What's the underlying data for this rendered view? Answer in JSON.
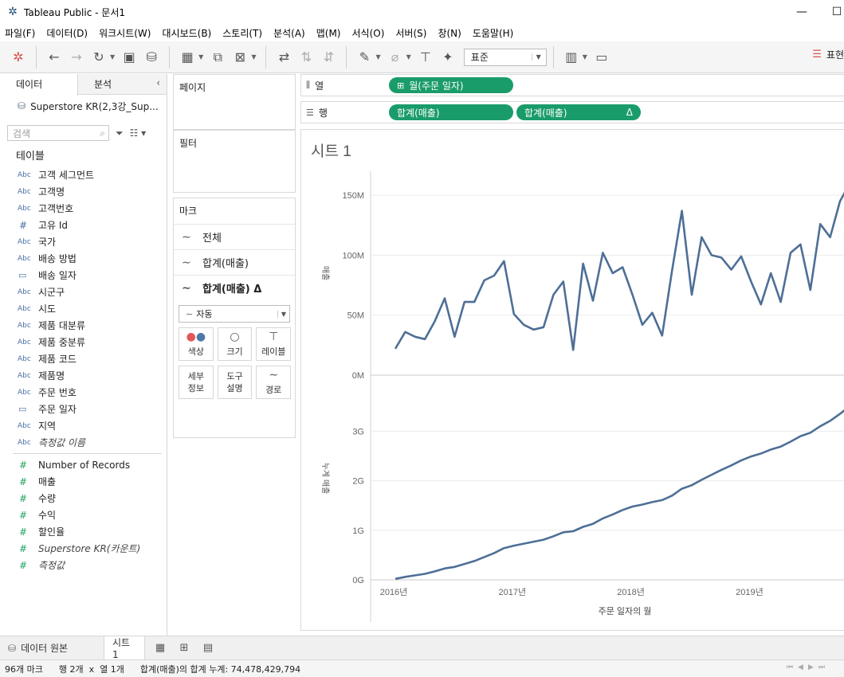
{
  "window": {
    "title": "Tableau Public - 문서1",
    "close_symbol": "✕",
    "maximize_symbol": "☐"
  },
  "menu": [
    "파일(F)",
    "데이터(D)",
    "워크시트(W)",
    "대시보드(B)",
    "스토리(T)",
    "분석(A)",
    "맵(M)",
    "서식(O)",
    "서버(S)",
    "창(N)",
    "도움말(H)"
  ],
  "toolbar": {
    "fit_select": "표준",
    "show_me": "표현"
  },
  "data_pane": {
    "tab_data": "데이터",
    "tab_analysis": "분석",
    "datasource": "Superstore KR(2,3강_Sup...",
    "search_placeholder": "검색",
    "tables_title": "테이블",
    "dim_type": "Abc",
    "measure_type": "#",
    "dimensions": [
      {
        "type": "abc",
        "name": "고객 세그먼트"
      },
      {
        "type": "abc",
        "name": "고객명"
      },
      {
        "type": "abc",
        "name": "고객번호"
      },
      {
        "type": "num",
        "name": "고유 Id"
      },
      {
        "type": "abc",
        "name": "국가"
      },
      {
        "type": "abc",
        "name": "배송 방법"
      },
      {
        "type": "date",
        "name": "배송 일자"
      },
      {
        "type": "abc",
        "name": "시군구"
      },
      {
        "type": "abc",
        "name": "시도"
      },
      {
        "type": "abc",
        "name": "제품 대분류"
      },
      {
        "type": "abc",
        "name": "제품 중분류"
      },
      {
        "type": "abc",
        "name": "제품 코드"
      },
      {
        "type": "abc",
        "name": "제품명"
      },
      {
        "type": "abc",
        "name": "주문 번호"
      },
      {
        "type": "date",
        "name": "주문 일자"
      },
      {
        "type": "abc",
        "name": "지역"
      },
      {
        "type": "abc",
        "name": "측정값 이름"
      }
    ],
    "measures": [
      "Number of Records",
      "매출",
      "수량",
      "수익",
      "할인율",
      "Superstore KR(카운트)",
      "측정값"
    ]
  },
  "cards": {
    "pages": "페이지",
    "filters": "필터",
    "marks": "마크",
    "mark_all": "전체",
    "mark_sum": "합계(매출)",
    "mark_sum_delta": "합계(매출) Δ",
    "mark_type": "자동",
    "buttons": [
      "색상",
      "크기",
      "레이블",
      "세부\n정보",
      "도구\n설명",
      "경로"
    ]
  },
  "shelves": {
    "columns_label": "열",
    "rows_label": "행",
    "columns_pill": "월(주문 일자)",
    "rows_pill_1": "합계(매출)",
    "rows_pill_2": "합계(매출)",
    "delta_symbol": "Δ",
    "plus_symbol": "⊞"
  },
  "sheet": {
    "title": "시트 1"
  },
  "chart_data": [
    {
      "type": "line",
      "title": "시트 1",
      "xlabel": "주문 일자의 월",
      "ylabel": "매출",
      "x_ticks": [
        "2016년",
        "2017년",
        "2018년",
        "2019년"
      ],
      "y_ticks": [
        "0M",
        "50M",
        "100M",
        "150M"
      ],
      "ylim": [
        0,
        170
      ],
      "x_start": "2016-01",
      "series": [
        {
          "values": [
            22,
            36,
            32,
            30,
            45,
            64,
            32,
            61,
            61,
            79,
            83,
            95,
            51,
            42,
            38,
            40,
            67,
            78,
            21,
            93,
            62,
            102,
            85,
            90,
            67,
            42,
            52,
            33,
            87,
            137,
            67,
            115,
            100,
            98,
            88,
            99,
            78,
            59,
            85,
            61,
            102,
            109,
            71,
            126,
            115,
            145,
            160
          ]
        }
      ]
    },
    {
      "type": "line",
      "title": "",
      "xlabel": "주문 일자의 월",
      "ylabel": "누계 매출",
      "y_ticks": [
        "0G",
        "1G",
        "2G",
        "3G"
      ],
      "ylim": [
        0,
        4.1
      ],
      "series": [
        {
          "values": [
            0.02,
            0.06,
            0.09,
            0.12,
            0.17,
            0.23,
            0.26,
            0.32,
            0.38,
            0.46,
            0.54,
            0.64,
            0.69,
            0.73,
            0.77,
            0.81,
            0.88,
            0.96,
            0.98,
            1.07,
            1.13,
            1.24,
            1.32,
            1.41,
            1.48,
            1.52,
            1.57,
            1.61,
            1.7,
            1.84,
            1.91,
            2.02,
            2.12,
            2.22,
            2.31,
            2.41,
            2.49,
            2.55,
            2.63,
            2.69,
            2.79,
            2.9,
            2.97,
            3.1,
            3.21,
            3.35,
            3.51
          ]
        }
      ]
    }
  ],
  "tabs": {
    "data_source": "데이터 원본",
    "sheet1": "시트 1"
  },
  "status": {
    "marks": "96개 마크",
    "rows_cols": "행 2개  x  열 1개",
    "sum": "합계(매출)의 합계 누계: 74,478,429,794"
  }
}
